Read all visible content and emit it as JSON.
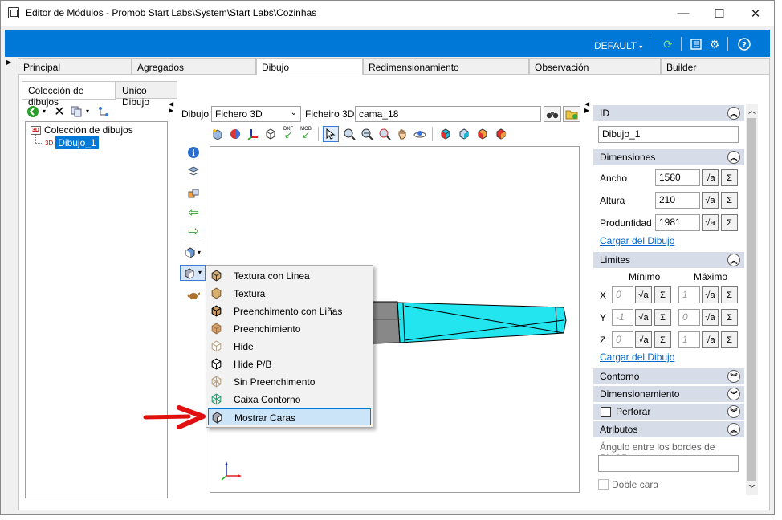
{
  "window": {
    "title": "Editor de Módulos - Promob Start Labs\\System\\Start Labs\\Cozinhas",
    "minimize": "—",
    "maximize": "☐",
    "close": "✕"
  },
  "toolbar": {
    "profile": "DEFAULT"
  },
  "tabs": [
    "Principal",
    "Agregados",
    "Dibujo",
    "Redimensionamiento",
    "Observación",
    "Builder"
  ],
  "subtabs": [
    "Colección de dibujos",
    "Unico Dibujo"
  ],
  "tree": {
    "root": "Colección de dibujos",
    "root_badge": "3D",
    "child": "Dibujo_1",
    "child_badge": "3D"
  },
  "drawing_bar": {
    "dibujo_label": "Dibujo",
    "dibujo_value": "Fichero 3D",
    "ficheiro_label": "Ficheiro 3D",
    "ficheiro_value": "cama_18"
  },
  "tool_labels": {
    "dxf": "DXF",
    "mob": "MOB"
  },
  "context_menu": {
    "items": [
      "Textura con Linea",
      "Textura",
      "Preenchimento con Liñas",
      "Preenchimiento",
      "Hide",
      "Hide P/B",
      "Sin Preenchimento",
      "Caixa Contorno",
      "Mostrar Caras"
    ],
    "highlighted_index": 8
  },
  "properties": {
    "id_header": "ID",
    "id_value": "Dibujo_1",
    "dim_header": "Dimensiones",
    "ancho_label": "Ancho",
    "ancho_value": "1580",
    "altura_label": "Altura",
    "altura_value": "210",
    "prof_label": "Produnfidad",
    "prof_value": "1981",
    "cargar_link": "Cargar del Dibujo",
    "limites_header": "Limites",
    "minimo_label": "Mínimo",
    "maximo_label": "Máximo",
    "x_label": "X",
    "y_label": "Y",
    "z_label": "Z",
    "x_min": "0",
    "x_max": "1",
    "y_min": "-1",
    "y_max": "0",
    "z_min": "0",
    "z_max": "1",
    "cargar_link2": "Cargar del Dibujo",
    "contorno_header": "Contorno",
    "dimensionamento_header": "Dimensionamiento",
    "perforar_label": "Perforar",
    "atributos_header": "Atributos",
    "angulo_label": "Ángulo entre los bordes de PMOB",
    "doble_cara_label": "Doble cara",
    "sigma": "Σ",
    "sqrt": "√a"
  },
  "colors": {
    "accent": "#0078d7",
    "section_header": "#d6dde9",
    "mesh_fill": "#22e5f0",
    "arrow": "#e01010"
  }
}
